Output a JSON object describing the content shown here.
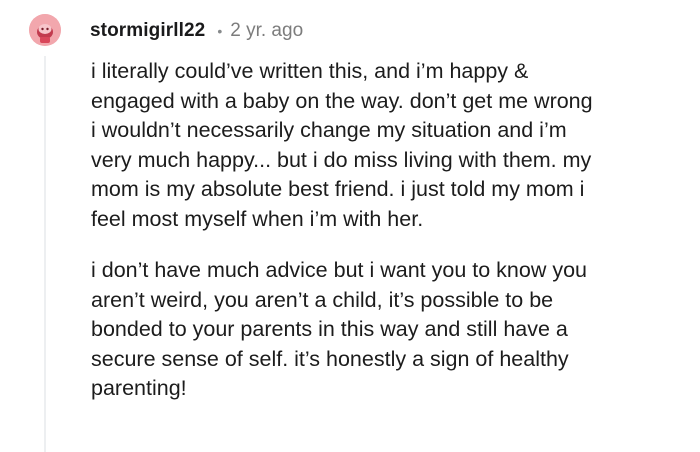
{
  "comment": {
    "username": "stormigirll22",
    "separator": "•",
    "age": "2 yr. ago",
    "paragraphs": [
      "i literally could’ve written this, and i’m happy &\nengaged with a baby on the way. don’t get me wrong\ni wouldn’t necessarily change my situation and i’m\nvery much happy... but i do miss living with them. my\nmom is my absolute best friend. i just told my mom i\nfeel most myself when i’m with her.",
      "i don’t have much advice but i want you to know you\naren’t weird, you aren’t a child, it’s possible to be\nbonded to your parents in this way and still have a\nsecure sense of self. it’s honestly a sign of healthy\nparenting!"
    ]
  },
  "avatar": {
    "icon": "snoo-avatar-icon",
    "background_color": "#f2a7ad"
  },
  "colors": {
    "text": "#1c1c1c",
    "meta": "#7c7c7c",
    "thread_line": "#edeff1"
  }
}
